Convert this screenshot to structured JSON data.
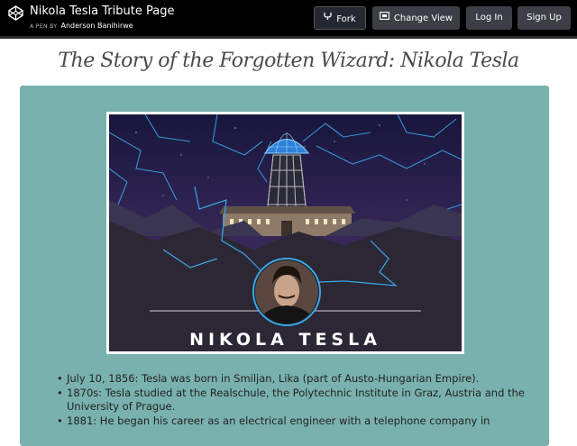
{
  "topbar": {
    "title": "Nikola Tesla Tribute Page",
    "meta_prefix": "A PEN BY",
    "author": "Anderson Banihirwe",
    "buttons": {
      "fork": "Fork",
      "change_view": "Change View",
      "login": "Log In",
      "signup": "Sign Up"
    },
    "icons": {
      "logo": "codepen-logo-icon",
      "fork": "fork-icon",
      "change_view": "layout-icon"
    }
  },
  "page": {
    "heading": "The Story of the Forgotten Wizard: Nikola Tesla",
    "image_caption": "NIKOLA TESLA",
    "timeline": [
      "July 10, 1856: Tesla was born in Smiljan, Lika (part of Austo-Hungarian Empire).",
      "1870s: Tesla studied at the Realschule, the Polytechnic Institute in Graz, Austria and the University of Prague.",
      "1881: He began his career as an electrical engineer with a telephone company in"
    ]
  },
  "colors": {
    "topbar_bg": "#000000",
    "panel_bg": "#79b1ae",
    "image_bg": "#0f0c29",
    "lightning": "#3aa8e8"
  }
}
